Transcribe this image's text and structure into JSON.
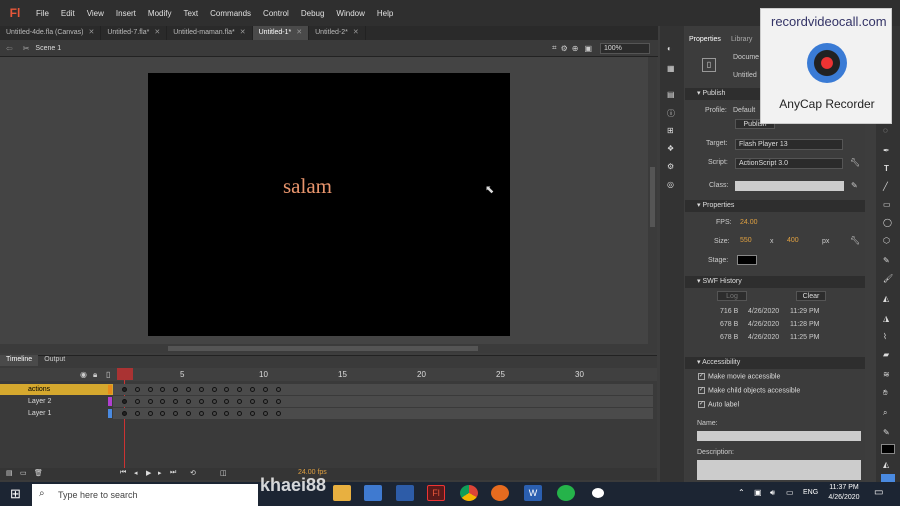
{
  "app": {
    "logo": "Fl"
  },
  "menu": [
    "File",
    "Edit",
    "View",
    "Insert",
    "Modify",
    "Text",
    "Commands",
    "Control",
    "Debug",
    "Window",
    "Help"
  ],
  "tabs": [
    {
      "label": "Untitled-4de.fla (Canvas)"
    },
    {
      "label": "Untitled-7.fla*"
    },
    {
      "label": "Untitled-maman.fla*"
    },
    {
      "label": "Untitled-1*",
      "active": true
    },
    {
      "label": "Untitled-2*"
    }
  ],
  "editbar": {
    "scene": "Scene 1",
    "zoom": "100%"
  },
  "stage": {
    "text": "salam",
    "bg": "#000000",
    "text_color": "#e8956d"
  },
  "timeline": {
    "tabs": [
      "Timeline",
      "Output"
    ],
    "frame_numbers": [
      "1",
      "5",
      "10",
      "15",
      "20",
      "25",
      "30"
    ],
    "layers": [
      {
        "name": "actions",
        "selected": true
      },
      {
        "name": "Layer 2"
      },
      {
        "name": "Layer 1"
      }
    ],
    "fps_readout": "24.00 fps"
  },
  "properties": {
    "tabs": [
      "Properties",
      "Library"
    ],
    "doc_label": "Docume",
    "doc_name": "Untitled",
    "publish_section": "Publish",
    "profile_label": "Profile:",
    "profile_value": "Default",
    "publish_button": "Publish",
    "target_label": "Target:",
    "target_value": "Flash Player 13",
    "script_label": "Script:",
    "script_value": "ActionScript 3.0",
    "class_label": "Class:",
    "props_section": "Properties",
    "fps_label": "FPS:",
    "fps_value": "24.00",
    "size_label": "Size:",
    "size_w": "550",
    "size_x": "x",
    "size_h": "400",
    "size_unit": "px",
    "stage_label": "Stage:",
    "swf_section": "SWF History",
    "log_button": "Log",
    "clear_button": "Clear",
    "swf_rows": [
      {
        "size": "716 B",
        "date": "4/26/2020",
        "time": "11:29 PM"
      },
      {
        "size": "678 B",
        "date": "4/26/2020",
        "time": "11:28 PM"
      },
      {
        "size": "678 B",
        "date": "4/26/2020",
        "time": "11:25 PM"
      }
    ],
    "access_section": "Accessibility",
    "chk_movie": "Make movie accessible",
    "chk_child": "Make child objects accessible",
    "chk_auto": "Auto label",
    "name_label": "Name:",
    "desc_label": "Description:"
  },
  "watermark": {
    "url": "recordvideocall.com",
    "name": "AnyCap Recorder"
  },
  "taskbar": {
    "search_placeholder": "Type here to search",
    "overlay_text": "khaei88",
    "lang": "ENG",
    "time": "11:37 PM",
    "date": "4/26/2020"
  }
}
